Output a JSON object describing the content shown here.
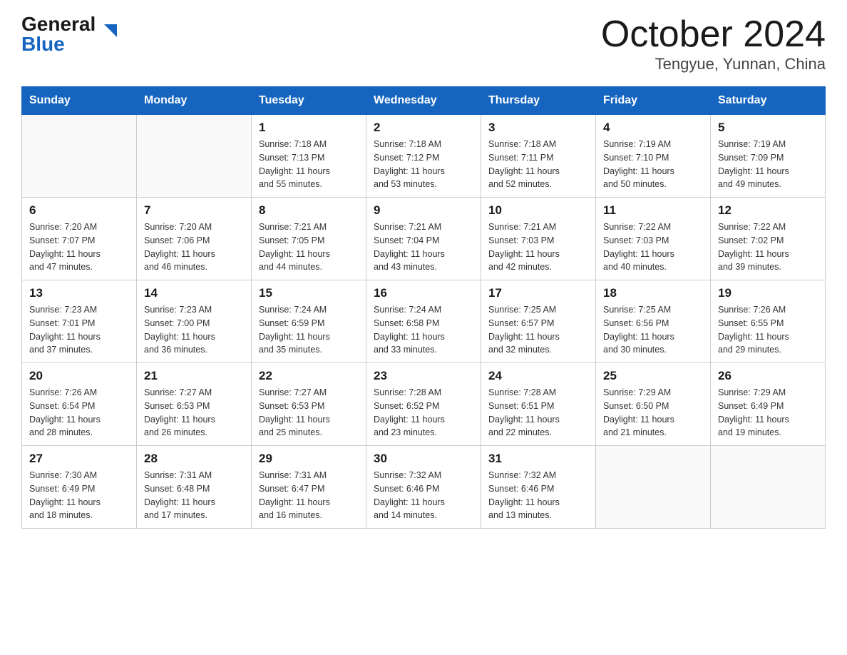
{
  "header": {
    "logo_general": "General",
    "logo_blue": "Blue",
    "title": "October 2024",
    "subtitle": "Tengyue, Yunnan, China"
  },
  "days_of_week": [
    "Sunday",
    "Monday",
    "Tuesday",
    "Wednesday",
    "Thursday",
    "Friday",
    "Saturday"
  ],
  "weeks": [
    [
      {
        "day": "",
        "info": ""
      },
      {
        "day": "",
        "info": ""
      },
      {
        "day": "1",
        "info": "Sunrise: 7:18 AM\nSunset: 7:13 PM\nDaylight: 11 hours\nand 55 minutes."
      },
      {
        "day": "2",
        "info": "Sunrise: 7:18 AM\nSunset: 7:12 PM\nDaylight: 11 hours\nand 53 minutes."
      },
      {
        "day": "3",
        "info": "Sunrise: 7:18 AM\nSunset: 7:11 PM\nDaylight: 11 hours\nand 52 minutes."
      },
      {
        "day": "4",
        "info": "Sunrise: 7:19 AM\nSunset: 7:10 PM\nDaylight: 11 hours\nand 50 minutes."
      },
      {
        "day": "5",
        "info": "Sunrise: 7:19 AM\nSunset: 7:09 PM\nDaylight: 11 hours\nand 49 minutes."
      }
    ],
    [
      {
        "day": "6",
        "info": "Sunrise: 7:20 AM\nSunset: 7:07 PM\nDaylight: 11 hours\nand 47 minutes."
      },
      {
        "day": "7",
        "info": "Sunrise: 7:20 AM\nSunset: 7:06 PM\nDaylight: 11 hours\nand 46 minutes."
      },
      {
        "day": "8",
        "info": "Sunrise: 7:21 AM\nSunset: 7:05 PM\nDaylight: 11 hours\nand 44 minutes."
      },
      {
        "day": "9",
        "info": "Sunrise: 7:21 AM\nSunset: 7:04 PM\nDaylight: 11 hours\nand 43 minutes."
      },
      {
        "day": "10",
        "info": "Sunrise: 7:21 AM\nSunset: 7:03 PM\nDaylight: 11 hours\nand 42 minutes."
      },
      {
        "day": "11",
        "info": "Sunrise: 7:22 AM\nSunset: 7:03 PM\nDaylight: 11 hours\nand 40 minutes."
      },
      {
        "day": "12",
        "info": "Sunrise: 7:22 AM\nSunset: 7:02 PM\nDaylight: 11 hours\nand 39 minutes."
      }
    ],
    [
      {
        "day": "13",
        "info": "Sunrise: 7:23 AM\nSunset: 7:01 PM\nDaylight: 11 hours\nand 37 minutes."
      },
      {
        "day": "14",
        "info": "Sunrise: 7:23 AM\nSunset: 7:00 PM\nDaylight: 11 hours\nand 36 minutes."
      },
      {
        "day": "15",
        "info": "Sunrise: 7:24 AM\nSunset: 6:59 PM\nDaylight: 11 hours\nand 35 minutes."
      },
      {
        "day": "16",
        "info": "Sunrise: 7:24 AM\nSunset: 6:58 PM\nDaylight: 11 hours\nand 33 minutes."
      },
      {
        "day": "17",
        "info": "Sunrise: 7:25 AM\nSunset: 6:57 PM\nDaylight: 11 hours\nand 32 minutes."
      },
      {
        "day": "18",
        "info": "Sunrise: 7:25 AM\nSunset: 6:56 PM\nDaylight: 11 hours\nand 30 minutes."
      },
      {
        "day": "19",
        "info": "Sunrise: 7:26 AM\nSunset: 6:55 PM\nDaylight: 11 hours\nand 29 minutes."
      }
    ],
    [
      {
        "day": "20",
        "info": "Sunrise: 7:26 AM\nSunset: 6:54 PM\nDaylight: 11 hours\nand 28 minutes."
      },
      {
        "day": "21",
        "info": "Sunrise: 7:27 AM\nSunset: 6:53 PM\nDaylight: 11 hours\nand 26 minutes."
      },
      {
        "day": "22",
        "info": "Sunrise: 7:27 AM\nSunset: 6:53 PM\nDaylight: 11 hours\nand 25 minutes."
      },
      {
        "day": "23",
        "info": "Sunrise: 7:28 AM\nSunset: 6:52 PM\nDaylight: 11 hours\nand 23 minutes."
      },
      {
        "day": "24",
        "info": "Sunrise: 7:28 AM\nSunset: 6:51 PM\nDaylight: 11 hours\nand 22 minutes."
      },
      {
        "day": "25",
        "info": "Sunrise: 7:29 AM\nSunset: 6:50 PM\nDaylight: 11 hours\nand 21 minutes."
      },
      {
        "day": "26",
        "info": "Sunrise: 7:29 AM\nSunset: 6:49 PM\nDaylight: 11 hours\nand 19 minutes."
      }
    ],
    [
      {
        "day": "27",
        "info": "Sunrise: 7:30 AM\nSunset: 6:49 PM\nDaylight: 11 hours\nand 18 minutes."
      },
      {
        "day": "28",
        "info": "Sunrise: 7:31 AM\nSunset: 6:48 PM\nDaylight: 11 hours\nand 17 minutes."
      },
      {
        "day": "29",
        "info": "Sunrise: 7:31 AM\nSunset: 6:47 PM\nDaylight: 11 hours\nand 16 minutes."
      },
      {
        "day": "30",
        "info": "Sunrise: 7:32 AM\nSunset: 6:46 PM\nDaylight: 11 hours\nand 14 minutes."
      },
      {
        "day": "31",
        "info": "Sunrise: 7:32 AM\nSunset: 6:46 PM\nDaylight: 11 hours\nand 13 minutes."
      },
      {
        "day": "",
        "info": ""
      },
      {
        "day": "",
        "info": ""
      }
    ]
  ],
  "colors": {
    "header_bg": "#1565c0",
    "header_text": "#ffffff",
    "border": "#cccccc",
    "day_number": "#1a1a1a"
  }
}
